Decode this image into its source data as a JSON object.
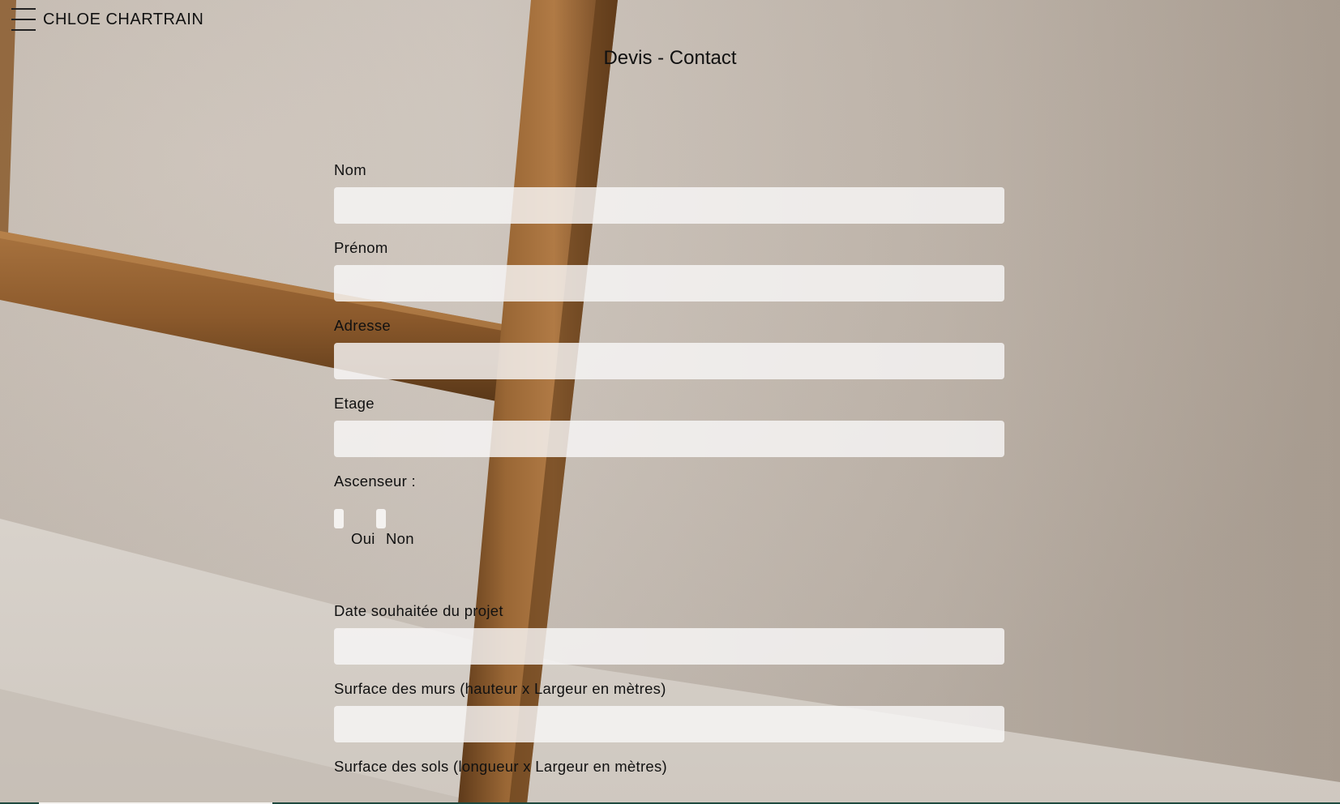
{
  "header": {
    "brand": "CHLOE CHARTRAIN",
    "menu_icon": "hamburger-menu-icon"
  },
  "page": {
    "title": "Devis - Contact"
  },
  "form": {
    "nom_label": "Nom",
    "nom_value": "",
    "prenom_label": "Prénom",
    "prenom_value": "",
    "adresse_label": "Adresse",
    "adresse_value": "",
    "etage_label": "Etage",
    "etage_value": "",
    "ascenseur_label": "Ascenseur :",
    "ascenseur_options": [
      "Oui",
      "Non"
    ],
    "date_label": "Date souhaitée du projet",
    "date_value": "",
    "surface_murs_label": "Surface des murs (hauteur x Largeur en mètres)",
    "surface_murs_value": "",
    "surface_sols_label": "Surface des sols (longueur x Largeur en mètres)"
  },
  "colors": {
    "wall": "#c9bfb5",
    "wood": "#8a5a2b",
    "field_bg": "#f8f7f6",
    "footer_accent": "#1f4a3f"
  }
}
